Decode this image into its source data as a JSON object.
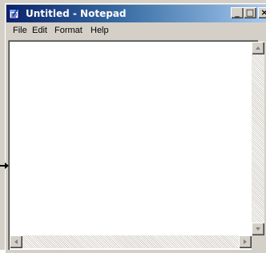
{
  "window": {
    "title": "Untitled - Notepad",
    "titlebar_colors": [
      "#0a246a",
      "#a6caf0"
    ],
    "buttons": {
      "minimize": "_",
      "maximize": "□",
      "close": "×"
    }
  },
  "menubar": {
    "items": [
      {
        "label": "File"
      },
      {
        "label": "Edit"
      },
      {
        "label": "Format"
      },
      {
        "label": "Help"
      }
    ]
  },
  "editor": {
    "content": ""
  },
  "icons": {
    "app": "notepad-icon",
    "scroll_up": "arrow-up-icon",
    "scroll_down": "arrow-down-icon",
    "scroll_left": "arrow-left-icon",
    "scroll_right": "arrow-right-icon",
    "pointer": "pointer-arrow-icon"
  }
}
